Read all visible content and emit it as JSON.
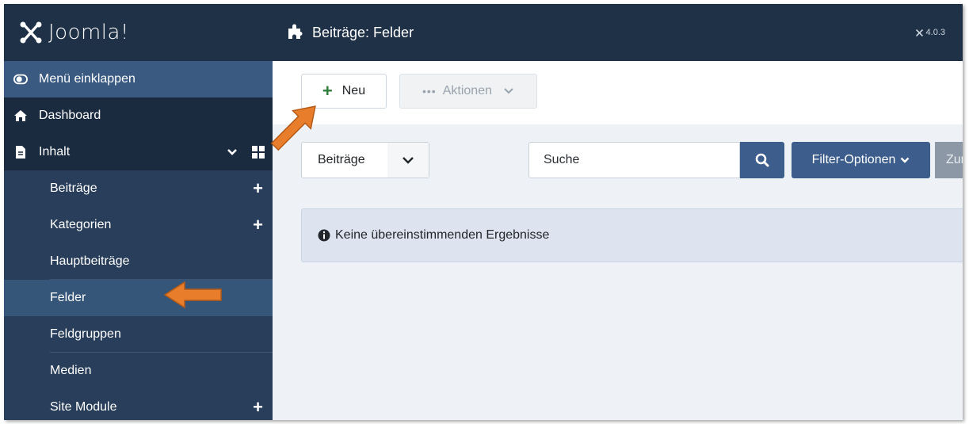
{
  "app": {
    "logo_text": "Joomla!",
    "version": "4.0.3"
  },
  "header": {
    "title": "Beiträge: Felder"
  },
  "sidebar": {
    "collapse_label": "Menü einklappen",
    "items": [
      {
        "label": "Dashboard",
        "icon": "home-icon"
      },
      {
        "label": "Inhalt",
        "icon": "file-icon"
      },
      {
        "label": "Beiträge",
        "has_add": true
      },
      {
        "label": "Kategorien",
        "has_add": true
      },
      {
        "label": "Hauptbeiträge"
      },
      {
        "label": "Felder",
        "active": true
      },
      {
        "label": "Feldgruppen"
      },
      {
        "label": "Medien"
      },
      {
        "label": "Site Module",
        "has_add": true
      }
    ]
  },
  "toolbar": {
    "new_label": "Neu",
    "actions_label": "Aktionen"
  },
  "filters": {
    "context_value": "Beiträge",
    "search_placeholder": "Suche",
    "filter_options_label": "Filter-Optionen",
    "reset_label": "Zur"
  },
  "alert": {
    "message": "Keine übereinstimmenden Ergebnisse"
  },
  "colors": {
    "sidebar_bg": "#1f3147",
    "accent": "#3d5e8c",
    "annotation_arrow": "#e87d2b",
    "new_plus": "#2f7d3a"
  }
}
